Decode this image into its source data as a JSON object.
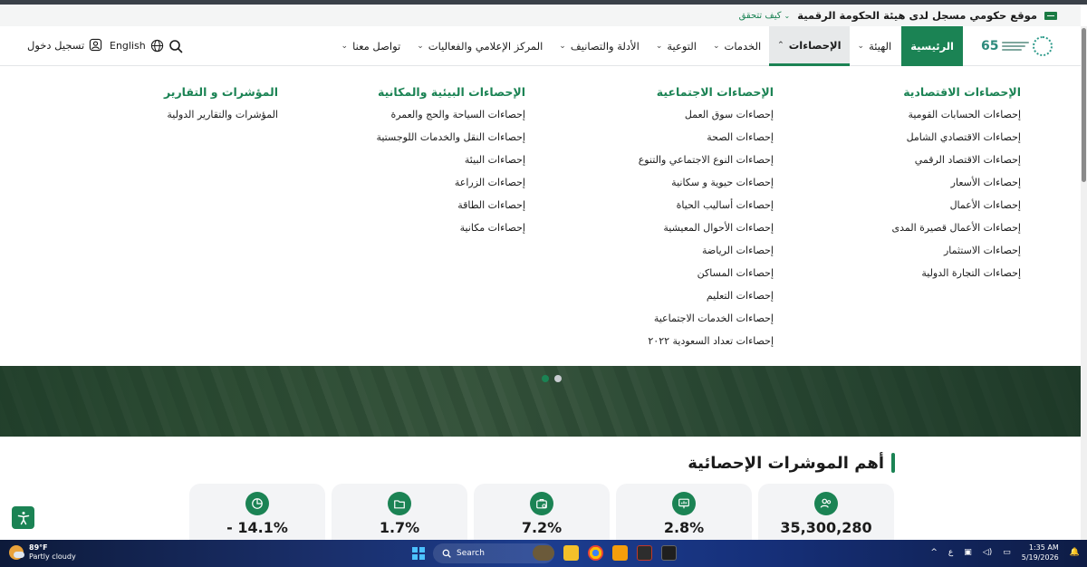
{
  "gov_banner": {
    "text": "موقع حكومي مسجل لدى هيئة الحكومة الرقمية",
    "how_to_verify": "كيف تتحقق"
  },
  "header": {
    "logo_text": "65",
    "nav": [
      {
        "label": "الرئيسية",
        "state": "home"
      },
      {
        "label": "الهيئة",
        "has_caret": true
      },
      {
        "label": "الإحصاءات",
        "has_caret": true,
        "state": "active"
      },
      {
        "label": "الخدمات",
        "has_caret": true
      },
      {
        "label": "التوعية",
        "has_caret": true
      },
      {
        "label": "الأدلة والتصانيف",
        "has_caret": true
      },
      {
        "label": "المركز الإعلامي والفعاليات",
        "has_caret": true
      },
      {
        "label": "تواصل معنا",
        "has_caret": true
      }
    ],
    "language": "English",
    "login": "تسجيل دخول"
  },
  "mega_menu": {
    "columns": [
      {
        "title": "الإحصاءات الاقتصادية",
        "items": [
          "إحصاءات الحسابات القومية",
          "إحصاءات الاقتصادي الشامل",
          "إحصاءات الاقتصاد الرقمي",
          "إحصاءات الأسعار",
          "إحصاءات الأعمال",
          "إحصاءات الأعمال قصيرة المدى",
          "إحصاءات الاستثمار",
          "إحصاءات التجارة الدولية"
        ]
      },
      {
        "title": "الإحصاءات الاجتماعية",
        "items": [
          "إحصاءات سوق العمل",
          "إحصاءات الصحة",
          "إحصاءات النوع الاجتماعي والتنوع",
          "إحصاءات حيوية و سكانية",
          "إحصاءات أساليب الحياة",
          "إحصاءات الأحوال المعيشية",
          "إحصاءات الرياضة",
          "إحصاءات المساكن",
          "إحصاءات التعليم",
          "إحصاءات الخدمات الاجتماعية",
          "إحصاءات تعداد السعودية ٢٠٢٢"
        ]
      },
      {
        "title": "الإحصاءات البيئية والمكانية",
        "items": [
          "إحصاءات السياحة والحج والعمرة",
          "إحصاءات النقل والخدمات اللوجستية",
          "إحصاءات البيئة",
          "إحصاءات الزراعة",
          "إحصاءات الطاقة",
          "إحصاءات مكانية"
        ]
      },
      {
        "title": "المؤشرات و التقارير",
        "items": [
          "المؤشرات والتقارير الدولية"
        ]
      }
    ]
  },
  "indicators": {
    "title": "أهم الموشرات الإحصائية",
    "cards": [
      {
        "value": "35,300,280",
        "icon": "users-icon"
      },
      {
        "value": "2.8%",
        "icon": "presentation-icon"
      },
      {
        "value": "7.2%",
        "icon": "briefcase-icon"
      },
      {
        "value": "1.7%",
        "icon": "folder-icon"
      },
      {
        "value": "- 14.1%",
        "icon": "pie-chart-icon"
      }
    ]
  },
  "taskbar": {
    "weather_temp": "89°F",
    "weather_desc": "Partly cloudy",
    "weather_badge": "6",
    "search_label": "Search",
    "time": "1:35 AM",
    "date": "5/19/2026",
    "tray_lang": "ع"
  },
  "colors": {
    "brand_green": "#1b8354",
    "card_bg": "#f3f4f6"
  }
}
